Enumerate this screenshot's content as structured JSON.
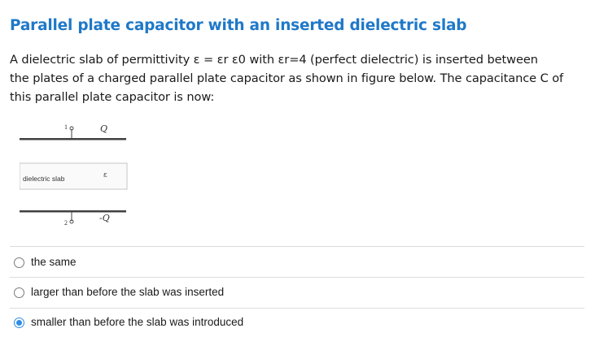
{
  "question": {
    "title": "Parallel plate capacitor with an inserted dielectric slab",
    "line1": "A dielectric slab of permittivity ε = εr ε0 with εr=4 (perfect dielectric) is inserted between",
    "line2": "the plates of a charged parallel plate capacitor as shown in figure below. The capacitance C of",
    "line3": "this parallel plate capacitor is now:"
  },
  "figure": {
    "terminal_top": "1",
    "terminal_bottom": "2",
    "charge_top": "Q",
    "charge_bottom": "-Q",
    "epsilon": "ε",
    "slab_label": "dielectric slab"
  },
  "answers": [
    {
      "label": "the same",
      "selected": false
    },
    {
      "label": "larger than before the slab was inserted",
      "selected": false
    },
    {
      "label": "smaller than before the slab was introduced",
      "selected": true
    }
  ]
}
